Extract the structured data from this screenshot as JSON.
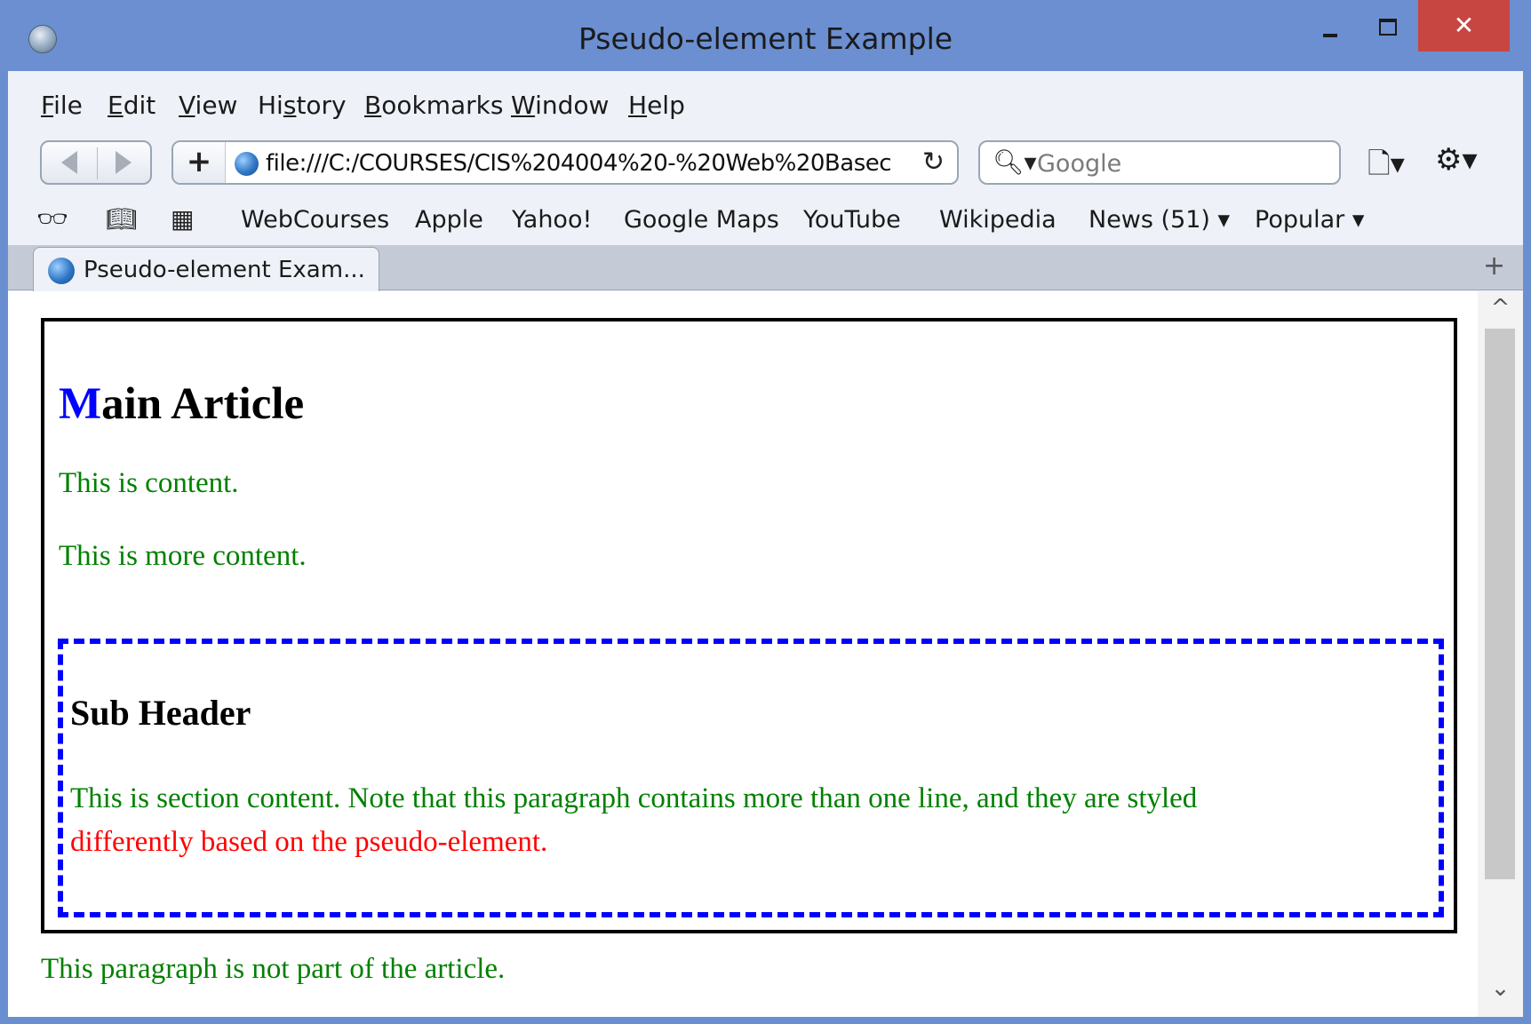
{
  "window": {
    "title": "Pseudo-element Example",
    "close_glyph": "✕"
  },
  "menu": {
    "items": [
      {
        "mnemonic": "F",
        "rest": "ile"
      },
      {
        "mnemonic": "E",
        "rest": "dit"
      },
      {
        "mnemonic": "V",
        "rest": "iew"
      },
      {
        "pre": "Hi",
        "mnemonic": "s",
        "rest": "tory"
      },
      {
        "mnemonic": "B",
        "rest": "ookmarks"
      },
      {
        "mnemonic": "W",
        "rest": "indow"
      },
      {
        "mnemonic": "H",
        "rest": "elp"
      }
    ]
  },
  "toolbar": {
    "add_glyph": "+",
    "url": "file:///C:/COURSES/CIS%204004%20-%20Web%20Basec",
    "reload_glyph": "↻",
    "search_icon_glyph": "🔍︎▾",
    "search_placeholder": "Google",
    "page_menu_glyph": "🗋▾",
    "gear_menu_glyph": "⚙▾"
  },
  "bookmarks": {
    "reader_glyph": "👓︎",
    "book_glyph": "📖︎",
    "grid_glyph": "▦",
    "items": [
      "WebCourses",
      "Apple",
      "Yahoo!",
      "Google Maps",
      "YouTube",
      "Wikipedia",
      "News (51) ▾",
      "Popular ▾"
    ]
  },
  "tabs": {
    "active_label": "Pseudo-element Exam...",
    "new_tab_glyph": "+"
  },
  "scrollbar": {
    "up_glyph": "^",
    "down_glyph": "⌄"
  },
  "page": {
    "main_title_first": "M",
    "main_title_rest": "ain Article",
    "p1": "This is content.",
    "p2": "This is more content.",
    "sub_header": "Sub Header",
    "section_line1": "This is section content. Note that this paragraph contains more than one line, and they are styled",
    "section_line2": "differently based on the pseudo-element.",
    "outside_p": "This paragraph is not part of the article.",
    "colors": {
      "first_letter": "#0000ff",
      "paragraph": "#008000",
      "second_line": "#ff0000",
      "section_border": "#0000ff",
      "article_border": "#000000"
    }
  }
}
